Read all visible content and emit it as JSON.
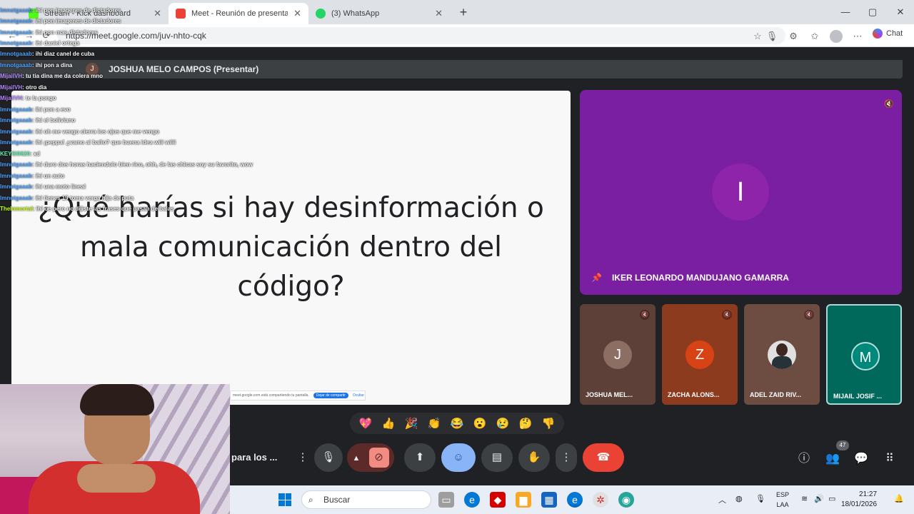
{
  "browser": {
    "tabs": [
      {
        "title": "Stream - Kick dashboard",
        "icon_color": "#53fc18"
      },
      {
        "title": "Meet - Reunión de presentaci",
        "icon_color": "#ea4335",
        "active": true
      },
      {
        "title": "(3) WhatsApp",
        "icon_color": "#25d366"
      }
    ],
    "url": "https://meet.google.com/juv-nhto-cqk",
    "chat_label": "Chat"
  },
  "meet": {
    "presenter_label": "JOSHUA MELO CAMPOS (Presentar)",
    "presenter_initial": "J",
    "slide_text": "¿Qué harías si hay desinformación o mala comunicación dentro del código?",
    "share_banner": {
      "text": "meet.google.com está compartiendo tu pantalla.",
      "stop": "Dejar de compartir",
      "hide": "Ocultar"
    },
    "pinned": {
      "name": "IKER LEONARDO MANDUJANO GAMARRA",
      "initial": "I",
      "color": "#7b1fa2"
    },
    "tiles": [
      {
        "name": "JOSHUA MEL...",
        "initial": "J",
        "bg": "#5d4037",
        "avatar": "#795548"
      },
      {
        "name": "ZACHA ALONS...",
        "initial": "Z",
        "bg": "#8d3b1f",
        "avatar": "#d84315"
      },
      {
        "name": "ADEL ZAID RIV...",
        "initial": "",
        "bg": "#6d4c41",
        "avatar": "#e0e0e0"
      },
      {
        "name": "MIJAIL JOSIF ...",
        "initial": "M",
        "bg": "#00695c",
        "avatar": "#00897b"
      }
    ],
    "meeting_title": "para los ...",
    "participant_count": "47",
    "reactions": [
      "💖",
      "👍",
      "🎉",
      "👏",
      "😂",
      "😮",
      "😢",
      "🤔",
      "👎"
    ]
  },
  "chat_overlay": [
    {
      "user": "lmnotgaaab",
      "msg": ": ihi pon imagenes de dictadores",
      "color": "#4da3ff"
    },
    {
      "user": "lmnotgaaab",
      "msg": ": ihi pon imagenes de dictadores",
      "color": "#4da3ff"
    },
    {
      "user": "lmnotgaaab",
      "msg": ": ihi pon mas dictadores",
      "color": "#4da3ff"
    },
    {
      "user": "lmnotgaaab",
      "msg": ": ihi daniel ortega",
      "color": "#4da3ff"
    },
    {
      "user": "lmnotgaaab",
      "msg": ": ihi diaz canel de cuba",
      "color": "#4da3ff"
    },
    {
      "user": "lmnotgaaab",
      "msg": ": ihi pon a dina",
      "color": "#4da3ff"
    },
    {
      "user": "MijailVH",
      "msg": ": tu tia dina me da colera mno",
      "color": "#b388ff"
    },
    {
      "user": "MijailVH",
      "msg": ": otro dia",
      "color": "#b388ff"
    },
    {
      "user": "MijailVH",
      "msg": ": te la pongo",
      "color": "#b388ff"
    },
    {
      "user": "lmnotgaaab",
      "msg": ": ihi pon a evo",
      "color": "#4da3ff"
    },
    {
      "user": "lmnotgaaab",
      "msg": ": ihi el boliviano",
      "color": "#4da3ff"
    },
    {
      "user": "lmnotgaaab",
      "msg": ": ihi oh me vengo cierra los ojos que me vengo",
      "color": "#4da3ff"
    },
    {
      "user": "lmnotgaaab",
      "msg": ": ihi ¡peppa! ¿vamo al baño? que buena idea wiii wiiii",
      "color": "#4da3ff"
    },
    {
      "user": "KEYSI0620",
      "msg": ": xd",
      "color": "#69f0ae"
    },
    {
      "user": "lmnotgaaab",
      "msg": ": ihi duro dos horas haciendolo bien rico, ohh, de las chicas soy su favorito, wow",
      "color": "#4da3ff"
    },
    {
      "user": "lmnotgaaab",
      "msg": ": ihi un auto",
      "color": "#4da3ff"
    },
    {
      "user": "lmnotgaaab",
      "msg": ": ihi una moto lineal",
      "color": "#4da3ff"
    },
    {
      "user": "lmnotgaaab",
      "msg": ": ihi tienes 19 toma verga hija de puta",
      "color": "#4da3ff"
    },
    {
      "user": "TheInmortal",
      "msg": ": ihi oe pero no dijiste las frases que pasan de balas",
      "color": "#c6ff00"
    }
  ],
  "taskbar": {
    "search_placeholder": "Buscar",
    "lang_top": "ESP",
    "lang_bottom": "LAA",
    "time": "21:27",
    "date": "18/01/2026"
  }
}
